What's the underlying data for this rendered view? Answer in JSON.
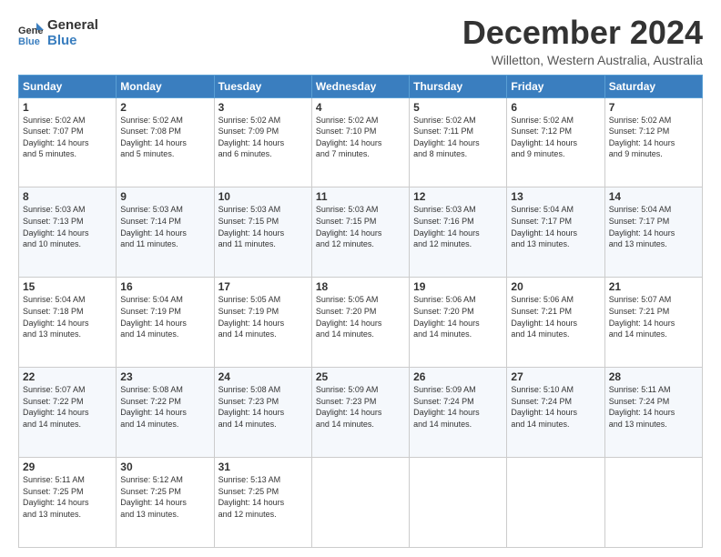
{
  "logo": {
    "line1": "General",
    "line2": "Blue"
  },
  "title": "December 2024",
  "subtitle": "Willetton, Western Australia, Australia",
  "headers": [
    "Sunday",
    "Monday",
    "Tuesday",
    "Wednesday",
    "Thursday",
    "Friday",
    "Saturday"
  ],
  "weeks": [
    [
      {
        "day": "1",
        "info": "Sunrise: 5:02 AM\nSunset: 7:07 PM\nDaylight: 14 hours\nand 5 minutes."
      },
      {
        "day": "2",
        "info": "Sunrise: 5:02 AM\nSunset: 7:08 PM\nDaylight: 14 hours\nand 5 minutes."
      },
      {
        "day": "3",
        "info": "Sunrise: 5:02 AM\nSunset: 7:09 PM\nDaylight: 14 hours\nand 6 minutes."
      },
      {
        "day": "4",
        "info": "Sunrise: 5:02 AM\nSunset: 7:10 PM\nDaylight: 14 hours\nand 7 minutes."
      },
      {
        "day": "5",
        "info": "Sunrise: 5:02 AM\nSunset: 7:11 PM\nDaylight: 14 hours\nand 8 minutes."
      },
      {
        "day": "6",
        "info": "Sunrise: 5:02 AM\nSunset: 7:12 PM\nDaylight: 14 hours\nand 9 minutes."
      },
      {
        "day": "7",
        "info": "Sunrise: 5:02 AM\nSunset: 7:12 PM\nDaylight: 14 hours\nand 9 minutes."
      }
    ],
    [
      {
        "day": "8",
        "info": "Sunrise: 5:03 AM\nSunset: 7:13 PM\nDaylight: 14 hours\nand 10 minutes."
      },
      {
        "day": "9",
        "info": "Sunrise: 5:03 AM\nSunset: 7:14 PM\nDaylight: 14 hours\nand 11 minutes."
      },
      {
        "day": "10",
        "info": "Sunrise: 5:03 AM\nSunset: 7:15 PM\nDaylight: 14 hours\nand 11 minutes."
      },
      {
        "day": "11",
        "info": "Sunrise: 5:03 AM\nSunset: 7:15 PM\nDaylight: 14 hours\nand 12 minutes."
      },
      {
        "day": "12",
        "info": "Sunrise: 5:03 AM\nSunset: 7:16 PM\nDaylight: 14 hours\nand 12 minutes."
      },
      {
        "day": "13",
        "info": "Sunrise: 5:04 AM\nSunset: 7:17 PM\nDaylight: 14 hours\nand 13 minutes."
      },
      {
        "day": "14",
        "info": "Sunrise: 5:04 AM\nSunset: 7:17 PM\nDaylight: 14 hours\nand 13 minutes."
      }
    ],
    [
      {
        "day": "15",
        "info": "Sunrise: 5:04 AM\nSunset: 7:18 PM\nDaylight: 14 hours\nand 13 minutes."
      },
      {
        "day": "16",
        "info": "Sunrise: 5:04 AM\nSunset: 7:19 PM\nDaylight: 14 hours\nand 14 minutes."
      },
      {
        "day": "17",
        "info": "Sunrise: 5:05 AM\nSunset: 7:19 PM\nDaylight: 14 hours\nand 14 minutes."
      },
      {
        "day": "18",
        "info": "Sunrise: 5:05 AM\nSunset: 7:20 PM\nDaylight: 14 hours\nand 14 minutes."
      },
      {
        "day": "19",
        "info": "Sunrise: 5:06 AM\nSunset: 7:20 PM\nDaylight: 14 hours\nand 14 minutes."
      },
      {
        "day": "20",
        "info": "Sunrise: 5:06 AM\nSunset: 7:21 PM\nDaylight: 14 hours\nand 14 minutes."
      },
      {
        "day": "21",
        "info": "Sunrise: 5:07 AM\nSunset: 7:21 PM\nDaylight: 14 hours\nand 14 minutes."
      }
    ],
    [
      {
        "day": "22",
        "info": "Sunrise: 5:07 AM\nSunset: 7:22 PM\nDaylight: 14 hours\nand 14 minutes."
      },
      {
        "day": "23",
        "info": "Sunrise: 5:08 AM\nSunset: 7:22 PM\nDaylight: 14 hours\nand 14 minutes."
      },
      {
        "day": "24",
        "info": "Sunrise: 5:08 AM\nSunset: 7:23 PM\nDaylight: 14 hours\nand 14 minutes."
      },
      {
        "day": "25",
        "info": "Sunrise: 5:09 AM\nSunset: 7:23 PM\nDaylight: 14 hours\nand 14 minutes."
      },
      {
        "day": "26",
        "info": "Sunrise: 5:09 AM\nSunset: 7:24 PM\nDaylight: 14 hours\nand 14 minutes."
      },
      {
        "day": "27",
        "info": "Sunrise: 5:10 AM\nSunset: 7:24 PM\nDaylight: 14 hours\nand 14 minutes."
      },
      {
        "day": "28",
        "info": "Sunrise: 5:11 AM\nSunset: 7:24 PM\nDaylight: 14 hours\nand 13 minutes."
      }
    ],
    [
      {
        "day": "29",
        "info": "Sunrise: 5:11 AM\nSunset: 7:25 PM\nDaylight: 14 hours\nand 13 minutes."
      },
      {
        "day": "30",
        "info": "Sunrise: 5:12 AM\nSunset: 7:25 PM\nDaylight: 14 hours\nand 13 minutes."
      },
      {
        "day": "31",
        "info": "Sunrise: 5:13 AM\nSunset: 7:25 PM\nDaylight: 14 hours\nand 12 minutes."
      },
      null,
      null,
      null,
      null
    ]
  ]
}
